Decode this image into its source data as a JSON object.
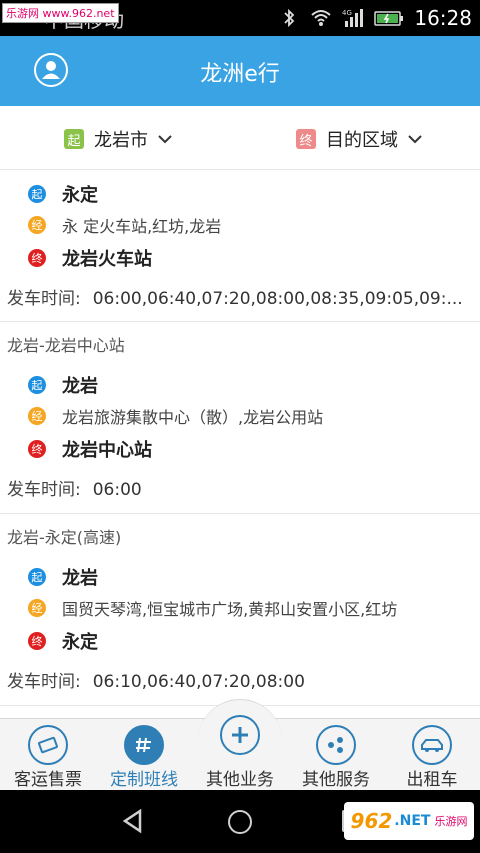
{
  "status_bar": {
    "carrier": "中国移动",
    "time": "16:28",
    "network_type": "4G",
    "watermark": "乐游网 www.962.net"
  },
  "header": {
    "title": "龙洲e行"
  },
  "filter": {
    "origin_tag": "起",
    "origin_value": "龙岩市",
    "destination_tag": "终",
    "destination_value": "目的区域"
  },
  "routes": [
    {
      "name": "",
      "start": "永定",
      "via": "永 定火车站,红坊,龙岩",
      "end": "龙岩火车站",
      "departure_label": "发车时间:",
      "departure_times": "06:00,06:40,07:20,08:00,08:35,09:05,09:..."
    },
    {
      "name": "龙岩-龙岩中心站",
      "start": "龙岩",
      "via": "龙岩旅游集散中心（散）,龙岩公用站",
      "end": "龙岩中心站",
      "departure_label": "发车时间:",
      "departure_times": "06:00"
    },
    {
      "name": "龙岩-永定(高速)",
      "start": "龙岩",
      "via": "国贸天琴湾,恒宝城市广场,黄邦山安置小区,红坊",
      "end": "永定",
      "departure_label": "发车时间:",
      "departure_times": "06:10,06:40,07:20,08:00"
    }
  ],
  "stop_badges": {
    "start": "起",
    "via": "经",
    "end": "终"
  },
  "tabs": [
    {
      "label": "客运售票",
      "icon": "ticket-icon"
    },
    {
      "label": "定制班线",
      "icon": "custom-route-icon",
      "active": true
    },
    {
      "label": "其他业务",
      "icon": "plus-icon"
    },
    {
      "label": "其他服务",
      "icon": "services-icon"
    },
    {
      "label": "出租车",
      "icon": "taxi-icon"
    }
  ],
  "bottom_watermark": {
    "number": "962",
    "suffix": ".NET",
    "text": "乐游网"
  },
  "colors": {
    "header_bg": "#3aa3e3",
    "badge_start": "#1e8fe0",
    "badge_via": "#f5a623",
    "badge_end": "#e02020",
    "tag_start": "#8bc34a",
    "tag_end": "#ef8a8a",
    "tab_accent": "#2f7fb6"
  }
}
